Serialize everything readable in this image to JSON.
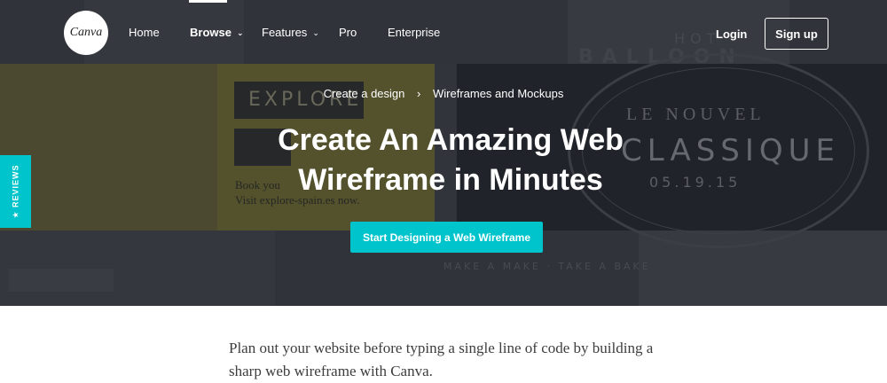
{
  "nav": {
    "logo_text": "Canva",
    "items": [
      {
        "label": "Home"
      },
      {
        "label": "Browse",
        "dropdown": true,
        "active": true
      },
      {
        "label": "Features",
        "dropdown": true
      },
      {
        "label": "Pro"
      },
      {
        "label": "Enterprise"
      }
    ],
    "login_label": "Login",
    "signup_label": "Sign up"
  },
  "hero": {
    "breadcrumb": [
      "Create a design",
      "Wireframes and Mockups"
    ],
    "breadcrumb_separator": "›",
    "title_line1": "Create An Amazing Web",
    "title_line2": "Wireframe in Minutes",
    "cta_label": "Start Designing a Web Wireframe",
    "background": {
      "explore": "EXPLORE",
      "yellow_line1": "Book you",
      "yellow_line2": "Visit explore-spain.es now.",
      "hot": "HOT",
      "balloon": "BALLOON",
      "nouvel": "LE NOUVEL",
      "classique": "CLASSIQUE",
      "date": "05.19.15",
      "make": "MAKE A MAKE · TAKE A BAKE"
    }
  },
  "reviews_tab": {
    "label": "★ REVIEWS"
  },
  "body": {
    "intro": "Plan out your website before typing a single line of code by building a sharp web wireframe with Canva."
  },
  "colors": {
    "accent": "#00c4cc",
    "hero_bg": "#3b3e46",
    "text_dark": "#3d3d3d"
  },
  "icons": {
    "dropdown": "chevron-down-icon",
    "breadcrumb_separator": "chevron-right-icon"
  }
}
